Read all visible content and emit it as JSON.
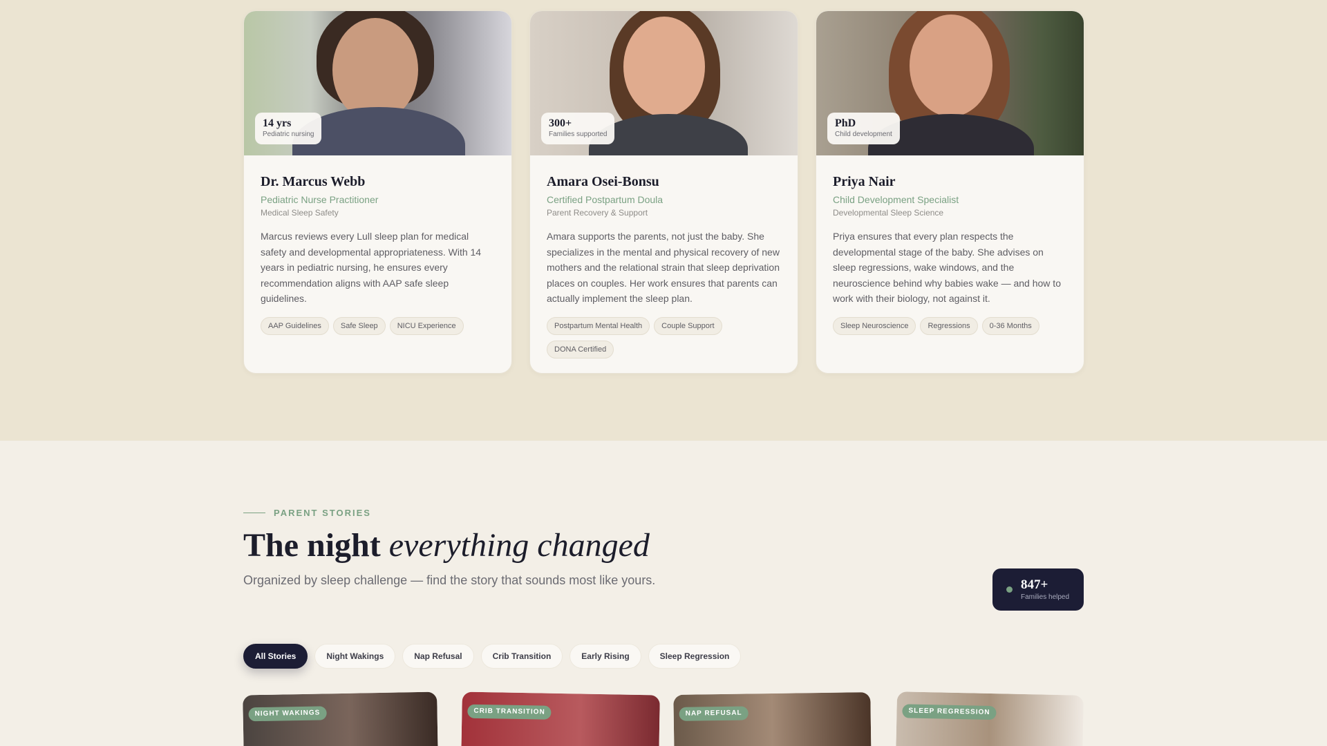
{
  "experts": [
    {
      "stat_value": "14 yrs",
      "stat_label": "Pediatric nursing",
      "name": "Dr. Marcus Webb",
      "role": "Pediatric Nurse Practitioner",
      "focus": "Medical Sleep Safety",
      "bio": "Marcus reviews every Lull sleep plan for medical safety and developmental appropriateness. With 14 years in pediatric nursing, he ensures every recommendation aligns with AAP safe sleep guidelines.",
      "tags": [
        "AAP Guidelines",
        "Safe Sleep",
        "NICU Experience"
      ]
    },
    {
      "stat_value": "300+",
      "stat_label": "Families supported",
      "name": "Amara Osei-Bonsu",
      "role": "Certified Postpartum Doula",
      "focus": "Parent Recovery & Support",
      "bio": "Amara supports the parents, not just the baby. She specializes in the mental and physical recovery of new mothers and the relational strain that sleep deprivation places on couples. Her work ensures that parents can actually implement the sleep plan.",
      "tags": [
        "Postpartum Mental Health",
        "Couple Support",
        "DONA Certified"
      ]
    },
    {
      "stat_value": "PhD",
      "stat_label": "Child development",
      "name": "Priya Nair",
      "role": "Child Development Specialist",
      "focus": "Developmental Sleep Science",
      "bio": "Priya ensures that every plan respects the developmental stage of the baby. She advises on sleep regressions, wake windows, and the neuroscience behind why babies wake — and how to work with their biology, not against it.",
      "tags": [
        "Sleep Neuroscience",
        "Regressions",
        "0-36 Months"
      ]
    }
  ],
  "stories": {
    "eyebrow": "PARENT STORIES",
    "headline_plain": "The night ",
    "headline_italic": "everything changed",
    "subtitle": "Organized by sleep challenge — find the story that sounds most like yours.",
    "families_value": "847+",
    "families_label": "Families helped",
    "filters": [
      "All Stories",
      "Night Wakings",
      "Nap Refusal",
      "Crib Transition",
      "Early Rising",
      "Sleep Regression"
    ],
    "active_filter": "All Stories",
    "cards": [
      {
        "tag": "NIGHT WAKINGS"
      },
      {
        "tag": "CRIB TRANSITION"
      },
      {
        "tag": "NAP REFUSAL"
      },
      {
        "tag": "SLEEP REGRESSION"
      }
    ]
  },
  "colors": {
    "accent": "#7aa183",
    "dark": "#1c1d35",
    "top_band": "#ebe4d2",
    "bottom_band": "#f3efe7"
  }
}
